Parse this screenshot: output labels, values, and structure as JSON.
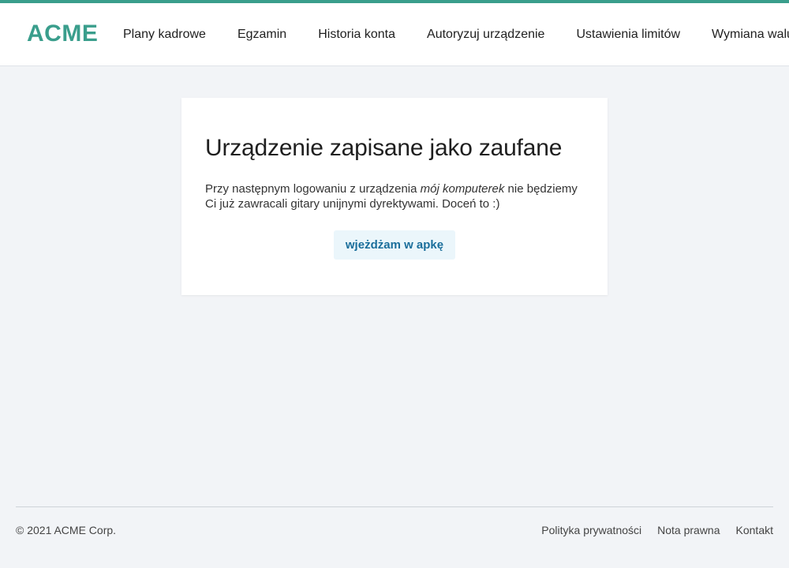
{
  "header": {
    "logo": "ACME",
    "nav": [
      "Plany kadrowe",
      "Egzamin",
      "Historia konta",
      "Autoryzuj urządzenie",
      "Ustawienia limitów",
      "Wymiana walut"
    ]
  },
  "card": {
    "title": "Urządzenie zapisane jako zaufane",
    "text_before": "Przy następnym logowaniu z urządzenia ",
    "device_name": "mój komputerek",
    "text_after": " nie będziemy Ci już zawracali gitary unijnymi dyrektywami. Doceń to :)",
    "button_label": "wjeżdżam w apkę"
  },
  "footer": {
    "copyright": "© 2021 ACME Corp.",
    "links": [
      "Polityka prywatności",
      "Nota prawna",
      "Kontakt"
    ]
  },
  "colors": {
    "accent": "#3a9e8c",
    "button_bg": "#ebf6fb",
    "button_text": "#1a6e9b",
    "page_bg": "#f2f4f7"
  }
}
